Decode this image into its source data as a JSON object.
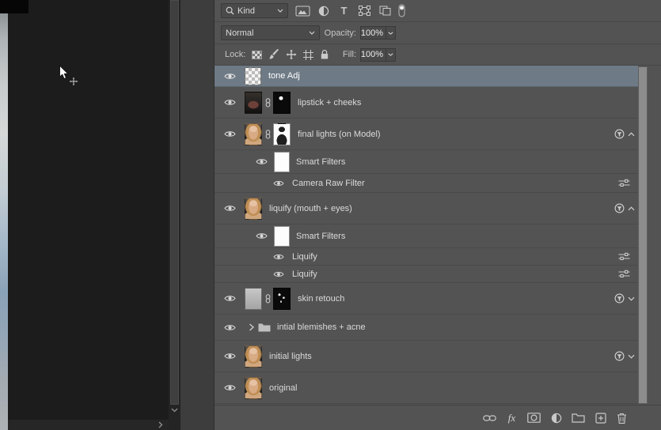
{
  "colors": {
    "panel_bg": "#535353",
    "selected_layer_bg": "#6e7a85",
    "canvas_bg": "#1c1c1c"
  },
  "filter_bar": {
    "kind_label": "Kind",
    "filter_type_label": "T",
    "icons": [
      "search-icon",
      "pixel-filter-icon",
      "adjustment-filter-icon",
      "type-filter-icon",
      "shape-filter-icon",
      "smart-object-filter-icon",
      "filter-toggle-switch"
    ]
  },
  "blend_bar": {
    "blend_mode": "Normal",
    "opacity_label": "Opacity:",
    "opacity_value": "100%"
  },
  "lock_bar": {
    "lock_label": "Lock:",
    "fill_label": "Fill:",
    "fill_value": "100%",
    "icons": [
      "lock-transparency-icon",
      "lock-pixels-icon",
      "lock-position-icon",
      "lock-artboard-icon",
      "lock-all-icon"
    ]
  },
  "layers": [
    {
      "name": "tone Adj",
      "selected": true,
      "visible": true,
      "thumb": "checkerboard"
    },
    {
      "name": "lipstick + cheeks",
      "visible": true,
      "thumb": "dark",
      "mask": "black-with-dot",
      "linked": true
    },
    {
      "name": "final lights (on Model)",
      "visible": true,
      "thumb": "portrait",
      "mask": "white-figure",
      "linked": true,
      "smart_filters": "expanded"
    },
    {
      "name": "Smart Filters",
      "visible": true,
      "thumb": "white"
    },
    {
      "name": "Camera Raw Filter",
      "visible": true
    },
    {
      "name": "liquify (mouth + eyes)",
      "visible": true,
      "thumb": "portrait",
      "smart_filters": "expanded"
    },
    {
      "name": "Smart Filters",
      "visible": true,
      "thumb": "white"
    },
    {
      "name": "Liquify",
      "visible": true
    },
    {
      "name": "Liquify",
      "visible": true
    },
    {
      "name": "skin retouch",
      "visible": true,
      "thumb": "gray",
      "mask": "black-with-specks",
      "linked": true,
      "smart_filters": "collapsed"
    },
    {
      "name": "intial blemishes + acne",
      "visible": true,
      "type": "group",
      "collapsed": true
    },
    {
      "name": "initial lights",
      "visible": true,
      "thumb": "portrait",
      "smart_filters": "collapsed"
    },
    {
      "name": "original",
      "visible": true,
      "thumb": "portrait"
    }
  ],
  "footer": {
    "fx_label": "fx",
    "icons": [
      "link-layers-icon",
      "layer-effects-icon",
      "add-mask-icon",
      "new-adjustment-icon",
      "new-group-icon",
      "new-layer-icon",
      "delete-layer-icon"
    ]
  }
}
